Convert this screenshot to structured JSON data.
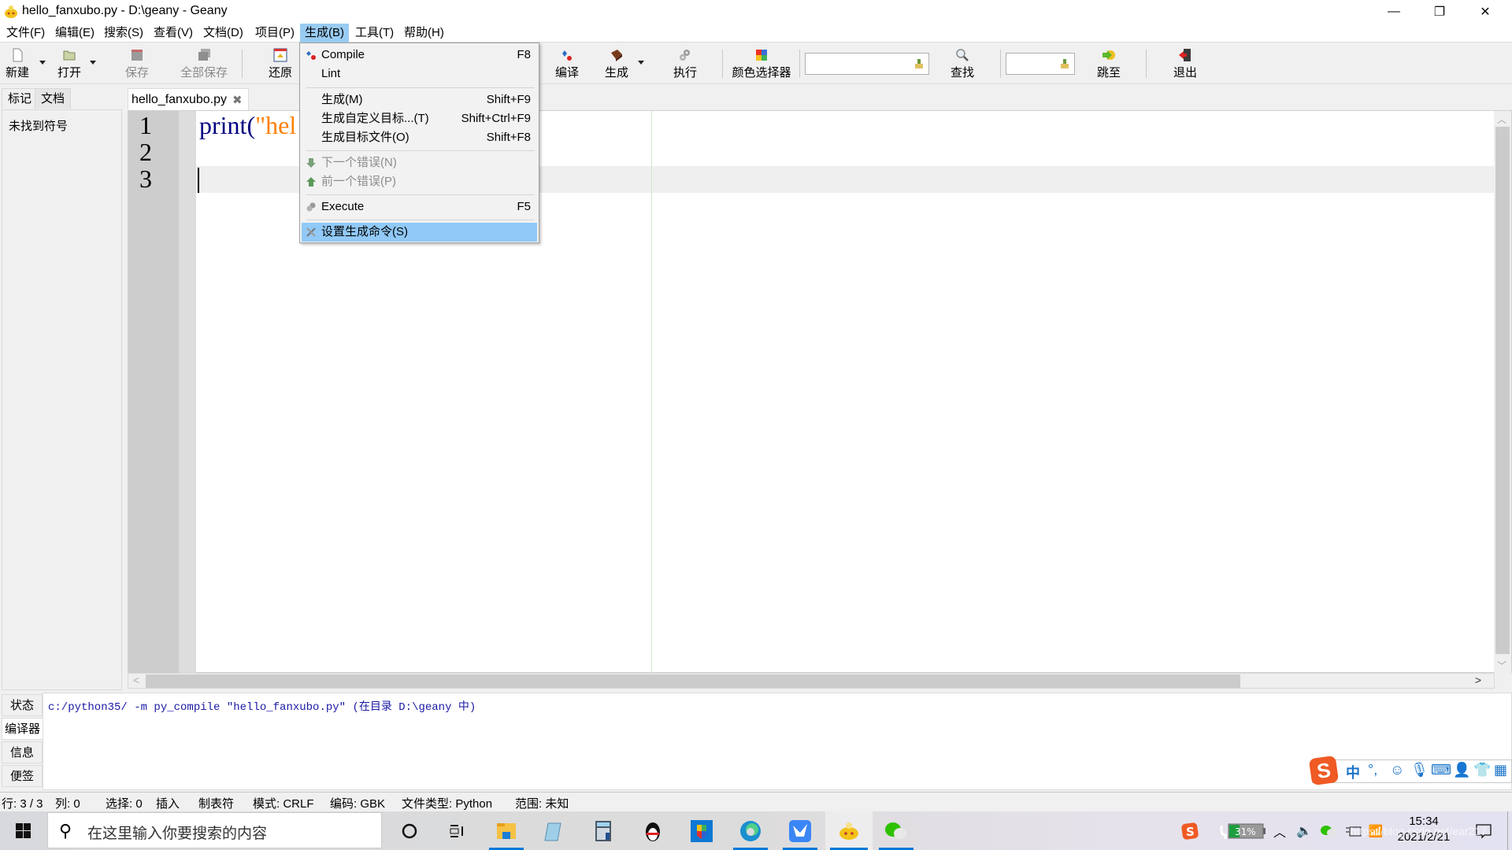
{
  "window": {
    "title": "hello_fanxubo.py - D:\\geany - Geany",
    "controls": {
      "minimize": "—",
      "maximize": "❐",
      "close": "✕"
    }
  },
  "menubar": {
    "items": [
      {
        "label": "文件(F)"
      },
      {
        "label": "编辑(E)"
      },
      {
        "label": "搜索(S)"
      },
      {
        "label": "查看(V)"
      },
      {
        "label": "文档(D)"
      },
      {
        "label": "项目(P)"
      },
      {
        "label": "生成(B)",
        "active": true
      },
      {
        "label": "工具(T)"
      },
      {
        "label": "帮助(H)"
      }
    ]
  },
  "toolbar": {
    "new": "新建",
    "open": "打开",
    "save": "保存",
    "save_all": "全部保存",
    "revert": "还原",
    "compile": "编译",
    "build": "生成",
    "execute": "执行",
    "color_picker": "颜色选择器",
    "search_input": "",
    "find": "查找",
    "goto_input": "",
    "goto": "跳至",
    "quit": "退出"
  },
  "sidebar": {
    "tabs": [
      {
        "label": "标记",
        "active": true
      },
      {
        "label": "文档",
        "active": false
      }
    ],
    "message": "未找到符号"
  },
  "editor": {
    "tab_label": "hello_fanxubo.py",
    "tab_close": "✖",
    "line_numbers": [
      "1",
      "2",
      "3"
    ],
    "lines": [
      {
        "keyword": "print",
        "paren": "(",
        "string": "\"hel"
      },
      {
        "text": ""
      },
      {
        "text": ""
      }
    ],
    "current_line": 3
  },
  "build_menu": {
    "items": [
      {
        "label": "Compile",
        "shortcut": "F8",
        "icon": "compile-icon"
      },
      {
        "label": "Lint",
        "shortcut": ""
      },
      {
        "separator": true
      },
      {
        "label": "生成(M)",
        "shortcut": "Shift+F9"
      },
      {
        "label": "生成自定义目标...(T)",
        "shortcut": "Shift+Ctrl+F9"
      },
      {
        "label": "生成目标文件(O)",
        "shortcut": "Shift+F8"
      },
      {
        "separator": true
      },
      {
        "label": "下一个错误(N)",
        "shortcut": "",
        "disabled": true,
        "icon": "arrow-down-icon"
      },
      {
        "label": "前一个错误(P)",
        "shortcut": "",
        "disabled": true,
        "icon": "arrow-up-icon"
      },
      {
        "separator": true
      },
      {
        "label": "Execute",
        "shortcut": "F5",
        "icon": "execute-gear-icon"
      },
      {
        "separator": true
      },
      {
        "label": "设置生成命令(S)",
        "shortcut": "",
        "highlighted": true,
        "icon": "tools-icon"
      }
    ]
  },
  "message_window": {
    "tabs": [
      {
        "label": "状态"
      },
      {
        "label": "编译器",
        "active": true
      },
      {
        "label": "信息"
      },
      {
        "label": "便签"
      }
    ],
    "compiler_output": "c:/python35/ -m py_compile \"hello_fanxubo.py\" (在目录 D:\\geany 中)"
  },
  "statusbar": {
    "line": "行: 3 / 3",
    "col": "列: 0",
    "sel": "选择: 0",
    "mode_ins": "插入",
    "indent": "制表符",
    "eol": "模式: CRLF",
    "encoding": "编码: GBK",
    "filetype": "文件类型: Python",
    "scope": "范围: 未知"
  },
  "ime": {
    "logo": "S",
    "lang": "中",
    "punct": "°,",
    "items": [
      "emoji-icon",
      "microphone-icon",
      "keyboard-icon",
      "user-icon",
      "skin-icon",
      "grid-icon"
    ]
  },
  "taskbar": {
    "search_placeholder": "在这里输入你要搜索的内容",
    "apps": [
      "cortana",
      "task-view",
      "file-explorer",
      "notepad",
      "calculator",
      "qq",
      "app-store",
      "edge",
      "feishu",
      "geany",
      "wechat"
    ],
    "battery": "31%",
    "battery_level": 0.31,
    "time": "15:34",
    "date": "2021/2/21",
    "watermark": "https://blog.csdn.net/ear217"
  },
  "colors": {
    "menu_highlight": "#91c9f7",
    "keyword": "#000080",
    "string": "#ff8000",
    "compiler_text": "#1a1aa6",
    "taskbar_accent": "#0078d7"
  }
}
